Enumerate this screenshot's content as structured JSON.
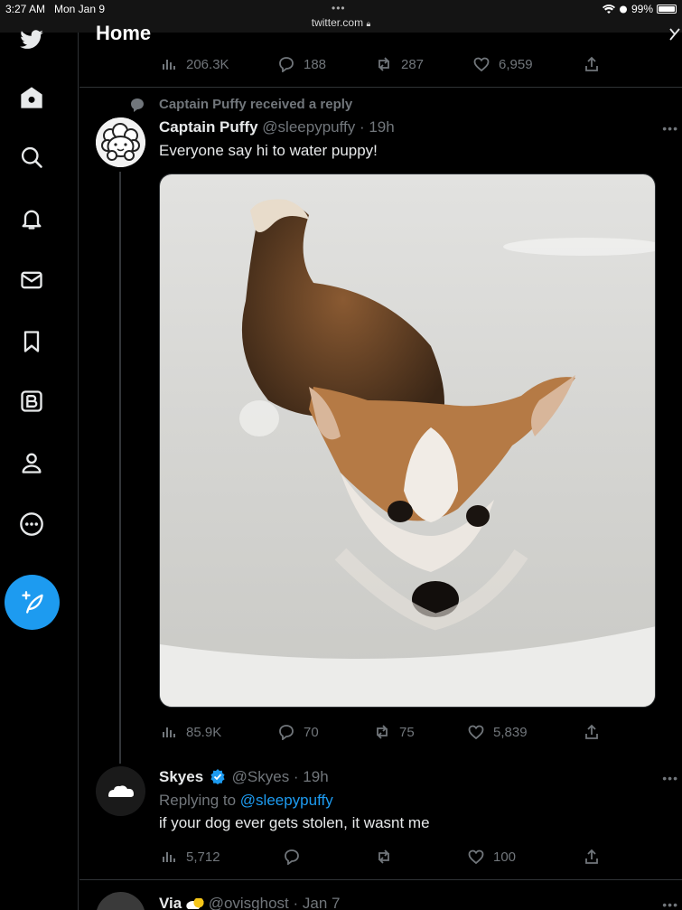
{
  "status_bar": {
    "time": "3:27 AM",
    "date": "Mon Jan 9",
    "url": "twitter.com",
    "battery": "99%"
  },
  "header": {
    "title": "Home"
  },
  "prev_tweet_stats": {
    "views": "206.3K",
    "replies": "188",
    "retweets": "287",
    "likes": "6,959"
  },
  "main_tweet": {
    "context": "Captain Puffy received a reply",
    "name": "Captain Puffy",
    "handle_time": "@sleepypuffy · 19h",
    "text": "Everyone say hi to water puppy!",
    "stats": {
      "views": "85.9K",
      "replies": "70",
      "retweets": "75",
      "likes": "5,839"
    }
  },
  "reply_tweet": {
    "name": "Skyes",
    "handle_time": "@Skyes · 19h",
    "replying_prefix": "Replying to ",
    "replying_handle": "@sleepypuffy",
    "text": "if your dog ever gets stolen, it wasnt me",
    "stats": {
      "views": "5,712",
      "replies": "",
      "retweets": "",
      "likes": "100"
    }
  },
  "next_tweet": {
    "name": "Via",
    "handle_time": "@ovisghost · Jan 7"
  },
  "colors": {
    "accent": "#1d9bf0",
    "muted": "#71767b",
    "border": "#2f3336"
  }
}
